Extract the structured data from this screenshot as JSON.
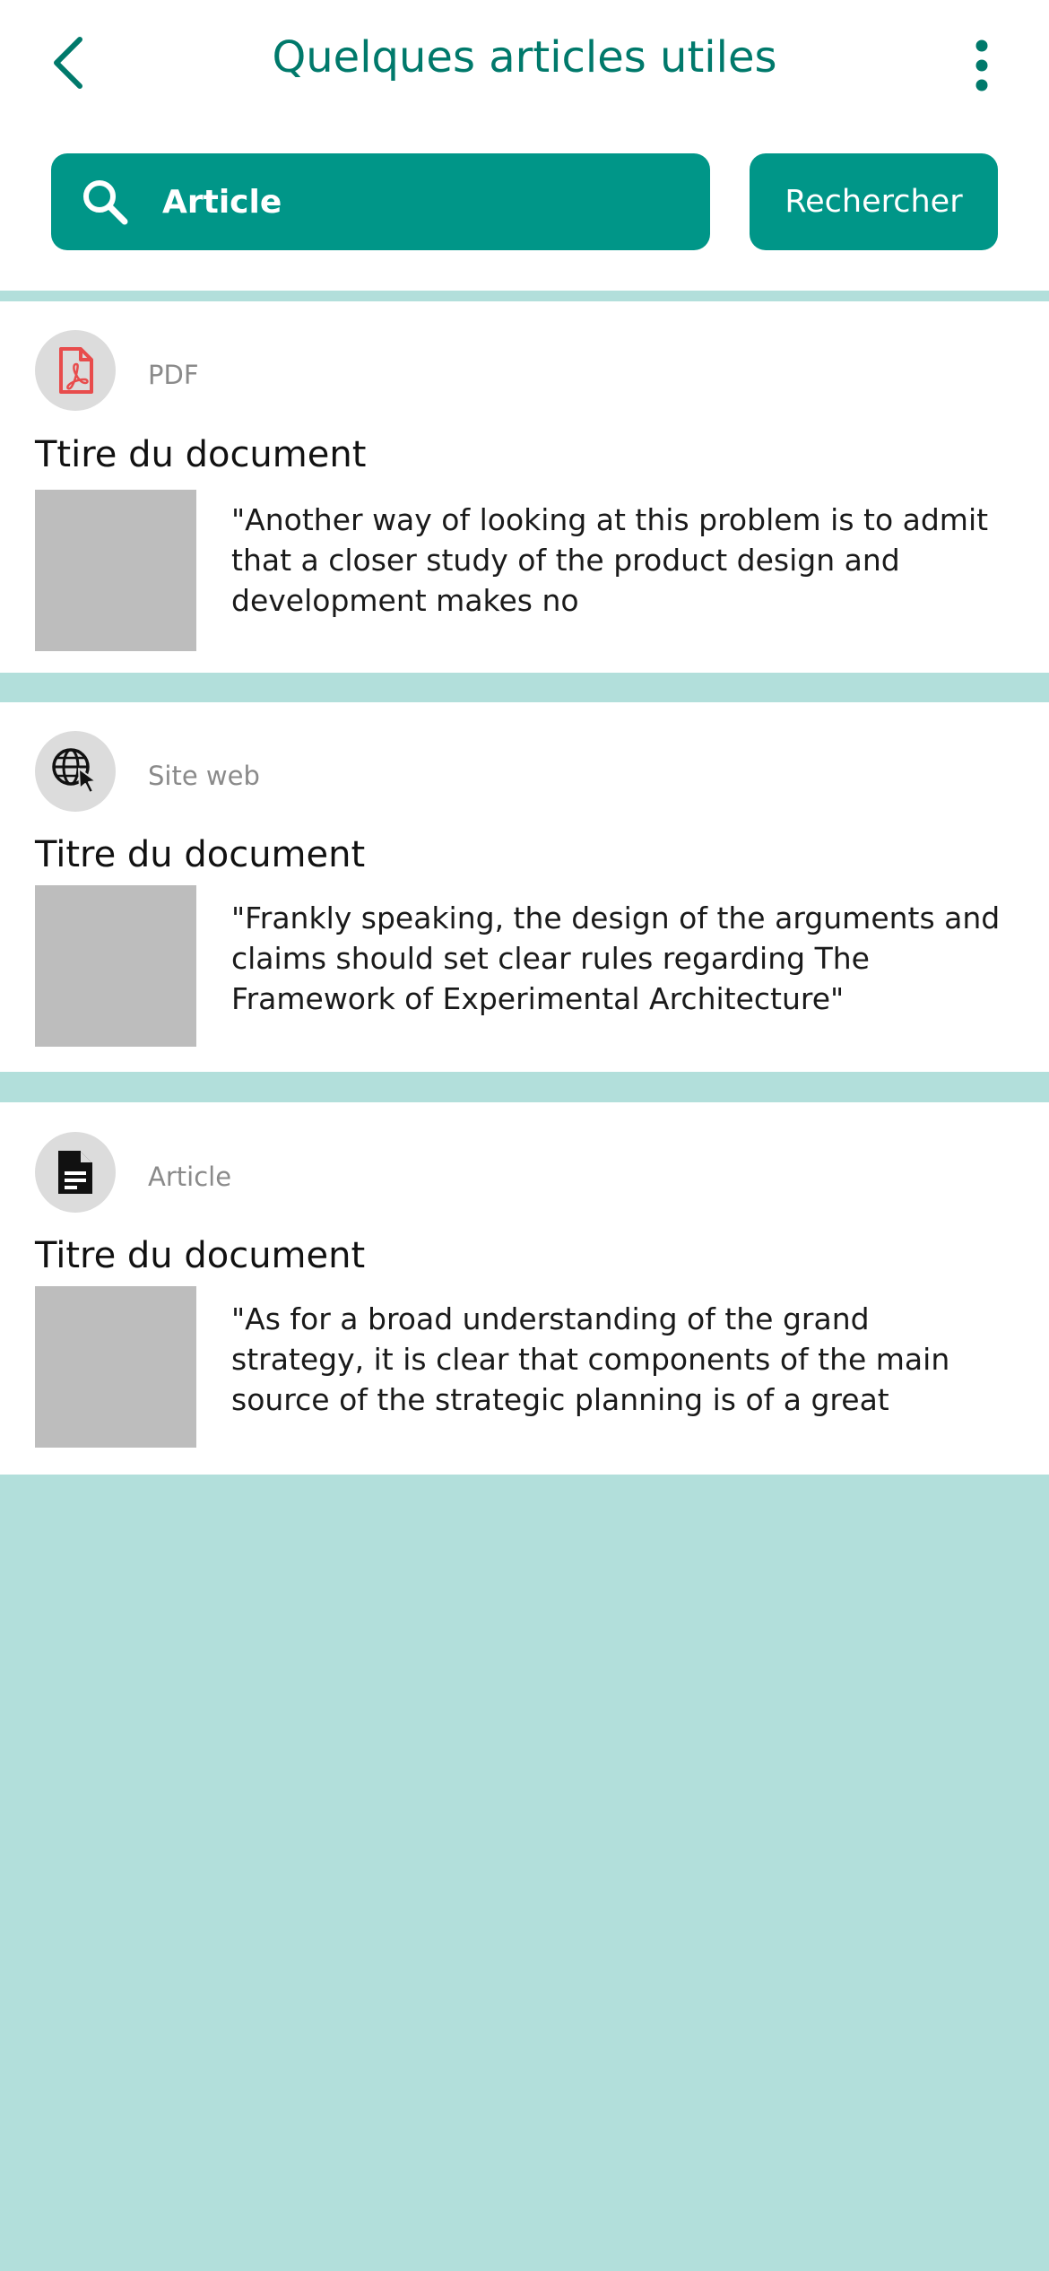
{
  "header": {
    "title": "Quelques articles utiles",
    "back_icon": "chevron-left-icon",
    "menu_icon": "more-vertical-icon"
  },
  "search": {
    "value": "Article",
    "button_label": "Rechercher",
    "icon": "search-icon"
  },
  "colors": {
    "primary": "#009688",
    "title": "#00796b",
    "background": "#b2dfdb",
    "pdf_icon": "#e84c4c"
  },
  "results": [
    {
      "type_label": "PDF",
      "icon": "pdf-file-icon",
      "title": "Ttire du document",
      "excerpt": "\"Another way of looking at this problem is to admit that a closer study of the product design and development makes no"
    },
    {
      "type_label": "Site web",
      "icon": "globe-cursor-icon",
      "title": "Titre du document",
      "excerpt": "\"Frankly speaking, the design of the arguments and claims should set clear rules regarding The Framework of Experimental Architecture\""
    },
    {
      "type_label": "Article",
      "icon": "article-icon",
      "title": "Titre du document",
      "excerpt": "\"As for a broad understanding of the grand strategy, it is clear that components of the main source of the strategic planning is of a great"
    }
  ]
}
